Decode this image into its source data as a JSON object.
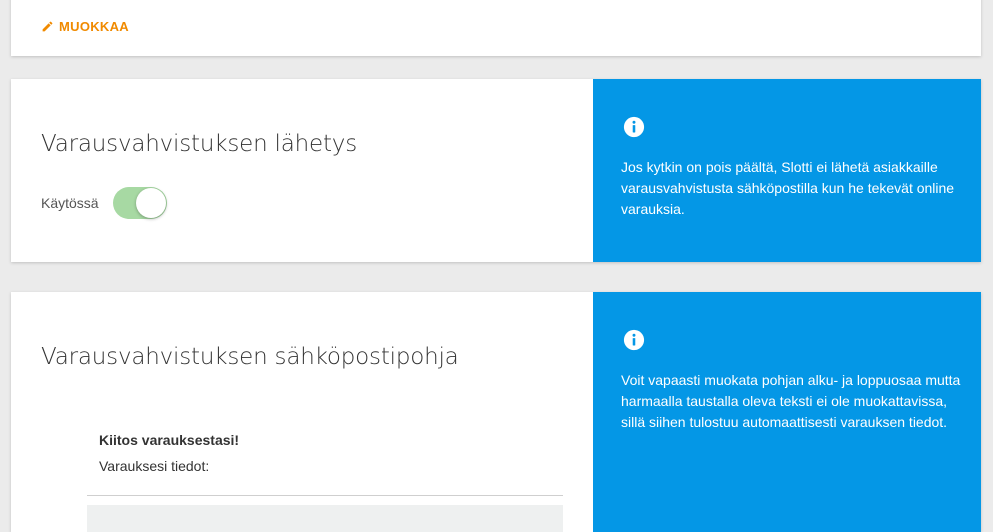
{
  "top_card": {
    "edit_label": "MUOKKAA",
    "edit_icon": "pencil-icon"
  },
  "confirmation_sending": {
    "title": "Varausvahvistuksen lähetys",
    "toggle_label": "Käytössä",
    "toggle_on": true,
    "info_icon": "info-icon",
    "info_text": "Jos kytkin on pois päältä, Slotti ei lähetä asiakkaille varausvahvistusta sähköpostilla kun he tekevät online varauksia."
  },
  "email_template": {
    "title": "Varausvahvistuksen sähköpostipohja",
    "greeting": "Kiitos varauksestasi!",
    "details_label": "Varauksesi tiedot:",
    "info_icon": "info-icon",
    "info_text": "Voit vapaasti muokata pohjan alku- ja loppuosaa mutta harmaalla taustalla oleva teksti ei ole muokattavissa, sillä siihen tulostuu automaattisesti varauksen tiedot."
  },
  "colors": {
    "accent_orange": "#f08a00",
    "info_blue": "#0497e6",
    "toggle_green": "#a7d9a3",
    "background": "#ebebeb"
  }
}
